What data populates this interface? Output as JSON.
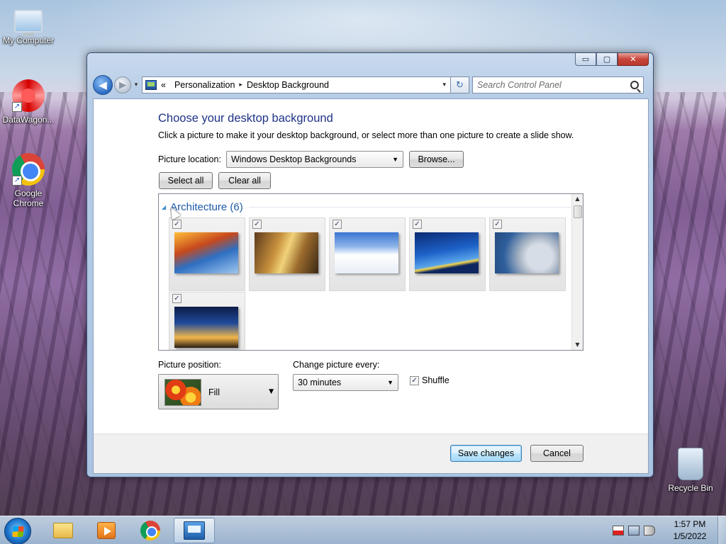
{
  "desktop": {
    "icons": [
      {
        "label": "My Computer",
        "icon": "computer-icon"
      },
      {
        "label": "DataWagon...",
        "icon": "datawagon-icon"
      },
      {
        "label": "Google Chrome",
        "icon": "chrome-icon"
      },
      {
        "label": "Recycle Bin",
        "icon": "recycle-bin-icon"
      }
    ]
  },
  "window": {
    "caption_buttons": {
      "minimize": "▭",
      "maximize": "▢",
      "close": "✕"
    },
    "nav": {
      "back": "◀",
      "forward": "▶",
      "history_dropdown": "▾",
      "crumb_prefix": "«",
      "crumbs": [
        "Personalization",
        "Desktop Background"
      ],
      "crumb_separator": "▸",
      "address_dropdown": "▾",
      "refresh": "↻",
      "search_placeholder": "Search Control Panel"
    },
    "content": {
      "heading": "Choose your desktop background",
      "subtext": "Click a picture to make it your desktop background, or select more than one picture to create a slide show.",
      "picture_location_label": "Picture location:",
      "picture_location_value": "Windows Desktop Backgrounds",
      "browse_label": "Browse...",
      "select_all_label": "Select all",
      "clear_all_label": "Clear all",
      "group_title": "Architecture (6)",
      "thumbnails": [
        {
          "checked": true,
          "check_glyph": "✓"
        },
        {
          "checked": true,
          "check_glyph": "✓"
        },
        {
          "checked": true,
          "check_glyph": "✓"
        },
        {
          "checked": true,
          "check_glyph": "✓"
        },
        {
          "checked": true,
          "check_glyph": "✓"
        },
        {
          "checked": true,
          "check_glyph": "✓"
        }
      ],
      "picture_position_label": "Picture position:",
      "picture_position_value": "Fill",
      "change_every_label": "Change picture every:",
      "change_every_value": "30 minutes",
      "shuffle_label": "Shuffle",
      "shuffle_checked": true,
      "save_label": "Save changes",
      "cancel_label": "Cancel"
    }
  },
  "taskbar": {
    "clock_time": "1:57 PM",
    "clock_date": "1/5/2022"
  },
  "colors": {
    "heading": "#1e3287",
    "group_title": "#1e5aa8",
    "close_button": "#c7463b"
  }
}
